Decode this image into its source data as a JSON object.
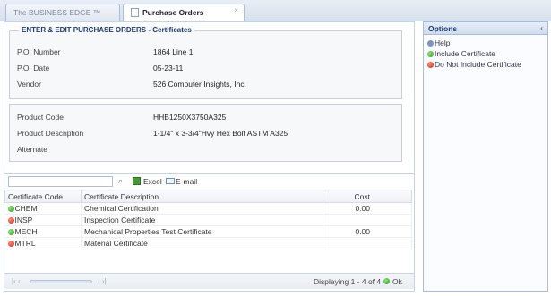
{
  "tabs": [
    {
      "label": "The BUSINESS EDGE ™"
    },
    {
      "label": "Purchase Orders",
      "close": "×"
    }
  ],
  "po_section": {
    "title": "ENTER & EDIT PURCHASE ORDERS - Certificates",
    "fields": [
      {
        "label": "P.O. Number",
        "value": "1864 Line 1"
      },
      {
        "label": "P.O. Date",
        "value": "05-23-11"
      },
      {
        "label": "Vendor",
        "value": "526 Computer Insights, Inc."
      }
    ]
  },
  "product_section": {
    "fields": [
      {
        "label": "Product Code",
        "value": "HHB1250X3750A325"
      },
      {
        "label": "Product Description",
        "value": "1-1/4\" x 3-3/4\"Hvy Hex Bolt ASTM A325"
      },
      {
        "label": "Alternate",
        "value": ""
      }
    ]
  },
  "toolbar": {
    "search_placeholder": "",
    "search_icon": "⌕",
    "excel_label": "Excel",
    "email_label": "E-mail"
  },
  "grid": {
    "columns": [
      "Certificate Code",
      "Certificate Description",
      "Cost"
    ],
    "rows": [
      {
        "status": "included",
        "code": "CHEM",
        "description": "Chemical Certification",
        "cost": "0.00"
      },
      {
        "status": "excluded",
        "code": "INSP",
        "description": "Inspection Certificate",
        "cost": ""
      },
      {
        "status": "included",
        "code": "MECH",
        "description": "Mechanical Properties Test Certificate",
        "cost": "0.00"
      },
      {
        "status": "excluded",
        "code": "MTRL",
        "description": "Material Certificate",
        "cost": ""
      }
    ]
  },
  "pager": {
    "first": "|‹ ‹",
    "next": "› ›|",
    "display": "Displaying 1 - 4 of 4",
    "ok": "Ok"
  },
  "options": {
    "title": "Options",
    "collapse": "‹",
    "items": [
      {
        "label": "Help"
      },
      {
        "label": "Include Certificate"
      },
      {
        "label": "Do Not Include Certificate"
      }
    ]
  },
  "colors": {
    "accent": "#1d3b6e",
    "included": "#2f9a1e",
    "excluded": "#cc2b19"
  }
}
